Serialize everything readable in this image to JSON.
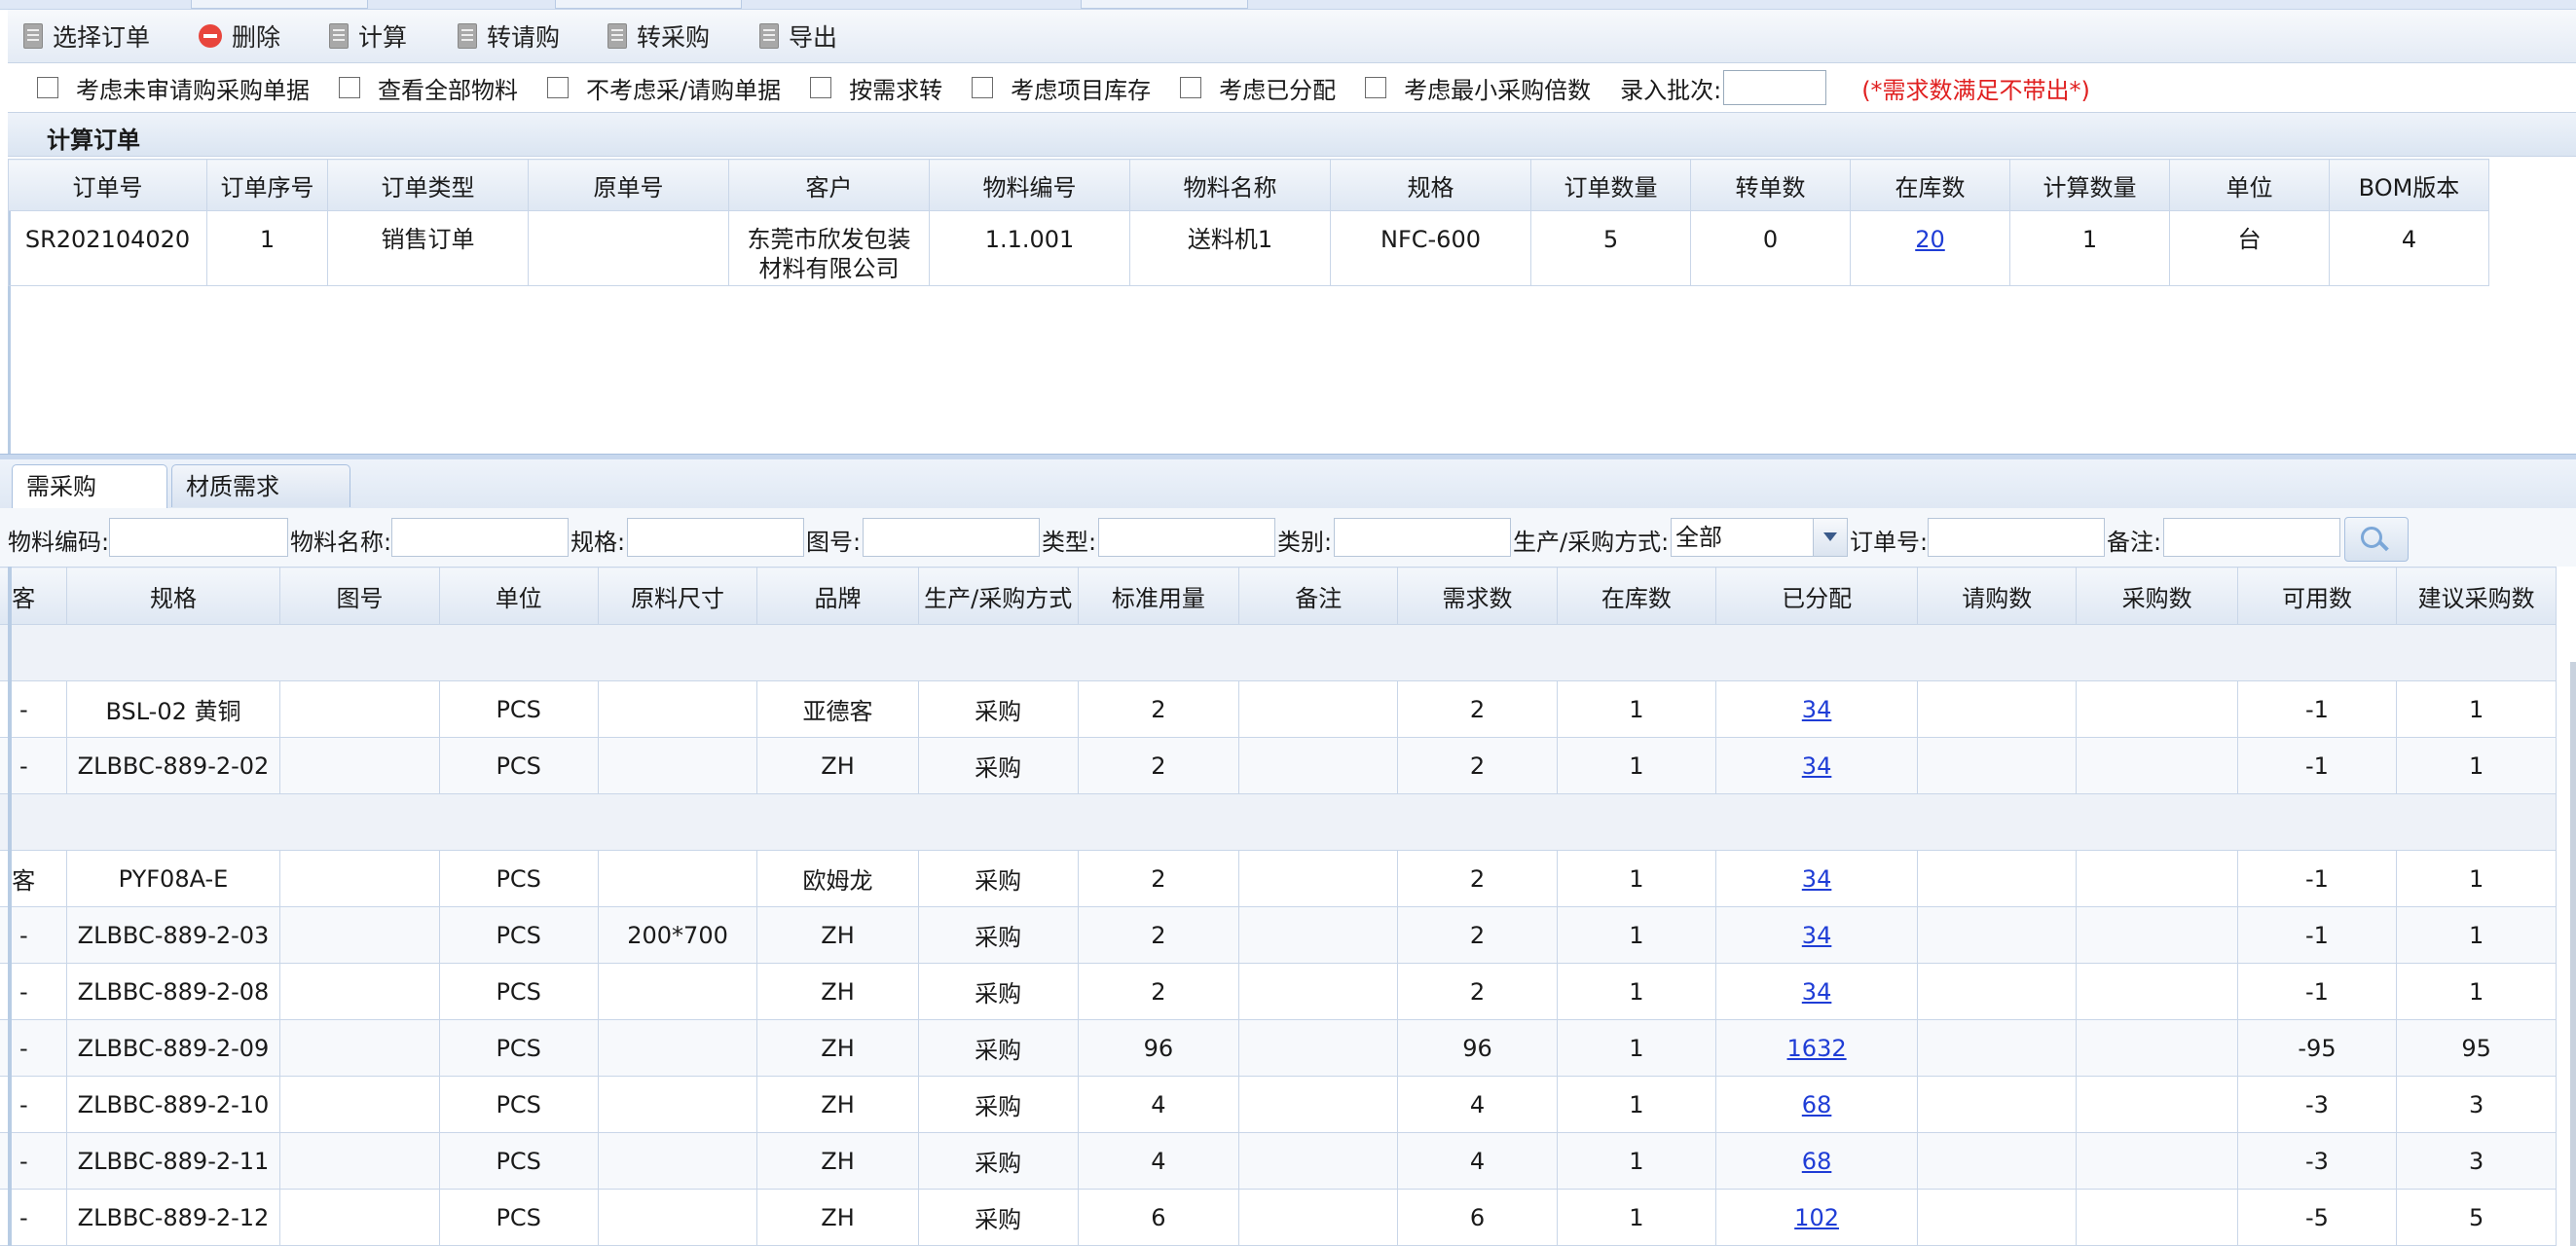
{
  "toolbar": {
    "select_order": "选择订单",
    "delete": "删除",
    "calculate": "计算",
    "to_requisition": "转请购",
    "to_purchase": "转采购",
    "export": "导出"
  },
  "options": {
    "opt1": "考虑未审请购采购单据",
    "opt2": "查看全部物料",
    "opt3": "不考虑采/请购单据",
    "opt4": "按需求转",
    "opt5": "考虑项目库存",
    "opt6": "考虑已分配",
    "opt7": "考虑最小采购倍数",
    "batch_label": "录入批次:",
    "tip": "(*需求数满足不带出*)"
  },
  "section_title": "计算订单",
  "order_grid": {
    "headers": [
      "订单号",
      "订单序号",
      "订单类型",
      "原单号",
      "客户",
      "物料编号",
      "物料名称",
      "规格",
      "订单数量",
      "转单数",
      "在库数",
      "计算数量",
      "单位",
      "BOM版本"
    ],
    "row": {
      "order_no": "SR202104020",
      "seq": "1",
      "type": "销售订单",
      "orig_no": "",
      "customer_line1": "东莞市欣发包装",
      "customer_line2": "材料有限公司",
      "material_no": "1.1.001",
      "material_name": "送料机1",
      "spec": "NFC-600",
      "order_qty": "5",
      "transferred": "0",
      "in_stock": "20",
      "calc_qty": "1",
      "unit": "台",
      "bom": "4"
    }
  },
  "tabs": {
    "purchase_needed": "需采购",
    "material_demand": "材质需求"
  },
  "filters": {
    "material_code": "物料编码:",
    "material_name": "物料名称:",
    "spec": "规格:",
    "drawing_no": "图号:",
    "type": "类型:",
    "category": "类别:",
    "prod_method": "生产/采购方式:",
    "prod_method_value": "全部",
    "order_no": "订单号:",
    "remark": "备注:"
  },
  "detail_grid": {
    "headers": [
      "客",
      "规格",
      "图号",
      "单位",
      "原料尺寸",
      "品牌",
      "生产/采购方式",
      "标准用量",
      "备注",
      "需求数",
      "在库数",
      "已分配",
      "请购数",
      "采购数",
      "可用数",
      "建议采购数"
    ],
    "rows": [
      {
        "lead": "-",
        "spec": "BSL-02 黄铜",
        "drawing": "",
        "unit": "PCS",
        "size": "",
        "brand": "亚德客",
        "method": "采购",
        "std": "2",
        "remark": "",
        "demand": "2",
        "stock": "1",
        "alloc": "34",
        "req": "",
        "pur": "",
        "avail": "-1",
        "suggest": "1"
      },
      {
        "lead": "-",
        "spec": "ZLBBC-889-2-02",
        "drawing": "",
        "unit": "PCS",
        "size": "",
        "brand": "ZH",
        "method": "采购",
        "std": "2",
        "remark": "",
        "demand": "2",
        "stock": "1",
        "alloc": "34",
        "req": "",
        "pur": "",
        "avail": "-1",
        "suggest": "1"
      },
      {
        "lead": "客",
        "spec": "PYF08A-E",
        "drawing": "",
        "unit": "PCS",
        "size": "",
        "brand": "欧姆龙",
        "method": "采购",
        "std": "2",
        "remark": "",
        "demand": "2",
        "stock": "1",
        "alloc": "34",
        "req": "",
        "pur": "",
        "avail": "-1",
        "suggest": "1"
      },
      {
        "lead": "-",
        "spec": "ZLBBC-889-2-03",
        "drawing": "",
        "unit": "PCS",
        "size": "200*700",
        "brand": "ZH",
        "method": "采购",
        "std": "2",
        "remark": "",
        "demand": "2",
        "stock": "1",
        "alloc": "34",
        "req": "",
        "pur": "",
        "avail": "-1",
        "suggest": "1"
      },
      {
        "lead": "-",
        "spec": "ZLBBC-889-2-08",
        "drawing": "",
        "unit": "PCS",
        "size": "",
        "brand": "ZH",
        "method": "采购",
        "std": "2",
        "remark": "",
        "demand": "2",
        "stock": "1",
        "alloc": "34",
        "req": "",
        "pur": "",
        "avail": "-1",
        "suggest": "1"
      },
      {
        "lead": "-",
        "spec": "ZLBBC-889-2-09",
        "drawing": "",
        "unit": "PCS",
        "size": "",
        "brand": "ZH",
        "method": "采购",
        "std": "96",
        "remark": "",
        "demand": "96",
        "stock": "1",
        "alloc": "1632",
        "req": "",
        "pur": "",
        "avail": "-95",
        "suggest": "95"
      },
      {
        "lead": "-",
        "spec": "ZLBBC-889-2-10",
        "drawing": "",
        "unit": "PCS",
        "size": "",
        "brand": "ZH",
        "method": "采购",
        "std": "4",
        "remark": "",
        "demand": "4",
        "stock": "1",
        "alloc": "68",
        "req": "",
        "pur": "",
        "avail": "-3",
        "suggest": "3"
      },
      {
        "lead": "-",
        "spec": "ZLBBC-889-2-11",
        "drawing": "",
        "unit": "PCS",
        "size": "",
        "brand": "ZH",
        "method": "采购",
        "std": "4",
        "remark": "",
        "demand": "4",
        "stock": "1",
        "alloc": "68",
        "req": "",
        "pur": "",
        "avail": "-3",
        "suggest": "3"
      },
      {
        "lead": "-",
        "spec": "ZLBBC-889-2-12",
        "drawing": "",
        "unit": "PCS",
        "size": "",
        "brand": "ZH",
        "method": "采购",
        "std": "6",
        "remark": "",
        "demand": "6",
        "stock": "1",
        "alloc": "102",
        "req": "",
        "pur": "",
        "avail": "-5",
        "suggest": "5"
      }
    ]
  }
}
